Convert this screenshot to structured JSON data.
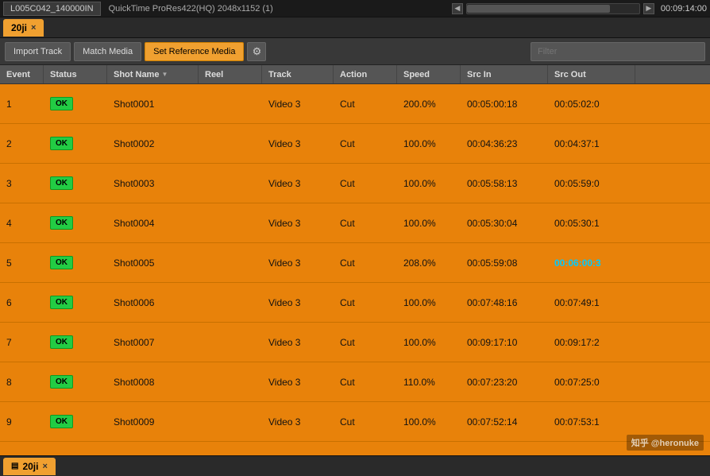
{
  "topbar": {
    "media_name": "L005C042_140000IN",
    "media_info": "QuickTime ProRes422(HQ)   2048x1152 (1)",
    "timecode": "00:09:14:00",
    "scroll_left": "◀",
    "scroll_right": "▶"
  },
  "tab": {
    "label": "20ji",
    "close": "×"
  },
  "toolbar": {
    "import_track": "Import Track",
    "match_media": "Match Media",
    "set_reference": "Set Reference Media",
    "gear_icon": "⚙",
    "filter_placeholder": "Filter"
  },
  "table": {
    "columns": [
      "Event",
      "Status",
      "Shot Name",
      "Reel",
      "Track",
      "Action",
      "Speed",
      "Src In",
      "Src Out"
    ],
    "rows": [
      {
        "event": "1",
        "status": "OK",
        "shot_name": "Shot0001",
        "reel": "",
        "track": "Video 3",
        "action": "Cut",
        "speed": "200.0%",
        "src_in": "00:05:00:18",
        "src_out": "00:05:02:0",
        "src_out_highlight": false
      },
      {
        "event": "2",
        "status": "OK",
        "shot_name": "Shot0002",
        "reel": "",
        "track": "Video 3",
        "action": "Cut",
        "speed": "100.0%",
        "src_in": "00:04:36:23",
        "src_out": "00:04:37:1",
        "src_out_highlight": false
      },
      {
        "event": "3",
        "status": "OK",
        "shot_name": "Shot0003",
        "reel": "",
        "track": "Video 3",
        "action": "Cut",
        "speed": "100.0%",
        "src_in": "00:05:58:13",
        "src_out": "00:05:59:0",
        "src_out_highlight": false
      },
      {
        "event": "4",
        "status": "OK",
        "shot_name": "Shot0004",
        "reel": "",
        "track": "Video 3",
        "action": "Cut",
        "speed": "100.0%",
        "src_in": "00:05:30:04",
        "src_out": "00:05:30:1",
        "src_out_highlight": false
      },
      {
        "event": "5",
        "status": "OK",
        "shot_name": "Shot0005",
        "reel": "",
        "track": "Video 3",
        "action": "Cut",
        "speed": "208.0%",
        "src_in": "00:05:59:08",
        "src_out": "00:06:00:3",
        "src_out_highlight": true
      },
      {
        "event": "6",
        "status": "OK",
        "shot_name": "Shot0006",
        "reel": "",
        "track": "Video 3",
        "action": "Cut",
        "speed": "100.0%",
        "src_in": "00:07:48:16",
        "src_out": "00:07:49:1",
        "src_out_highlight": false
      },
      {
        "event": "7",
        "status": "OK",
        "shot_name": "Shot0007",
        "reel": "",
        "track": "Video 3",
        "action": "Cut",
        "speed": "100.0%",
        "src_in": "00:09:17:10",
        "src_out": "00:09:17:2",
        "src_out_highlight": false
      },
      {
        "event": "8",
        "status": "OK",
        "shot_name": "Shot0008",
        "reel": "",
        "track": "Video 3",
        "action": "Cut",
        "speed": "110.0%",
        "src_in": "00:07:23:20",
        "src_out": "00:07:25:0",
        "src_out_highlight": false
      },
      {
        "event": "9",
        "status": "OK",
        "shot_name": "Shot0009",
        "reel": "",
        "track": "Video 3",
        "action": "Cut",
        "speed": "100.0%",
        "src_in": "00:07:52:14",
        "src_out": "00:07:53:1",
        "src_out_highlight": false
      }
    ]
  },
  "bottom_tab": {
    "label": "20ji",
    "close": "×",
    "icon": "timeline"
  },
  "watermark": "知乎 @heronuke"
}
